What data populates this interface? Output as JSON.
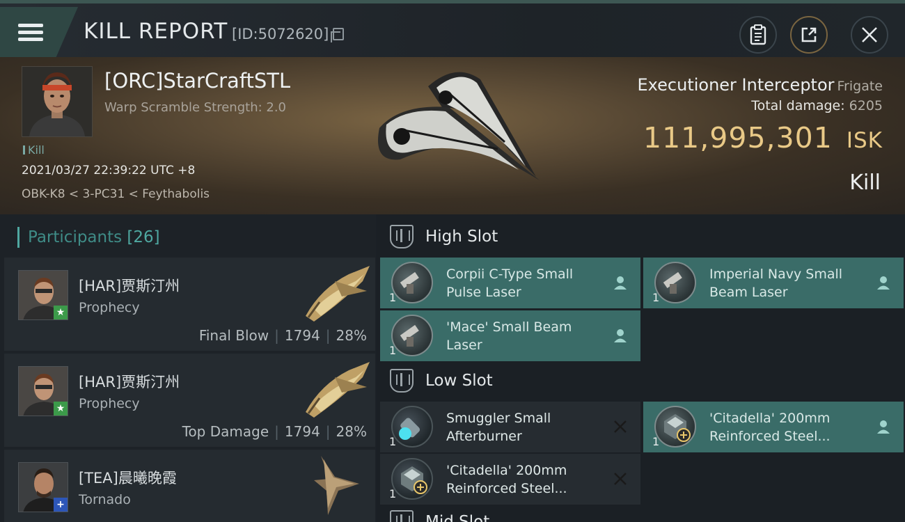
{
  "header": {
    "title": "KILL REPORT",
    "id_text": "[ID:5072620]"
  },
  "victim": {
    "name": "[ORC]StarCraftSTL",
    "warp_scramble": "Warp Scramble Strength: 2.0",
    "kill_tag": "Kill",
    "time": "2021/03/27 22:39:22 UTC +8",
    "location": "OBK-K8 < 3-PC31 < Feythabolis",
    "ship_name": "Executioner Interceptor",
    "ship_class": "Frigate",
    "total_damage_label": "Total damage:",
    "total_damage": "6205",
    "isk_value": "111,995,301",
    "isk_unit": "ISK",
    "result": "Kill"
  },
  "participants": {
    "label": "Participants",
    "count": "[26]",
    "rows": [
      {
        "name": "[HAR]贾斯汀州",
        "ship": "Prophecy",
        "role": "Final Blow",
        "damage": "1794",
        "percent": "28%",
        "badge": "★"
      },
      {
        "name": "[HAR]贾斯汀州",
        "ship": "Prophecy",
        "role": "Top Damage",
        "damage": "1794",
        "percent": "28%",
        "badge": "★"
      },
      {
        "name": "[TEA]晨曦晚霞",
        "ship": "Tornado",
        "role": "",
        "damage": "",
        "percent": "",
        "badge": "+"
      }
    ]
  },
  "fitting": {
    "high_slot": "High Slot",
    "low_slot": "Low Slot",
    "mid_slot": "Mid Slot",
    "high": [
      {
        "name": "Corpii C-Type Small Pulse Laser",
        "qty": "1",
        "status": "dropped"
      },
      {
        "name": "Imperial Navy Small Beam Laser",
        "qty": "1",
        "status": "dropped"
      },
      {
        "name": "'Mace' Small Beam Laser",
        "qty": "1",
        "status": "dropped"
      }
    ],
    "low": [
      {
        "name": "Smuggler Small Afterburner",
        "qty": "1",
        "status": "destroyed"
      },
      {
        "name": "'Citadella' 200mm Reinforced Steel...",
        "qty": "1",
        "status": "dropped"
      },
      {
        "name": "'Citadella' 200mm Reinforced Steel...",
        "qty": "1",
        "status": "destroyed"
      }
    ]
  },
  "colors": {
    "accent_teal": "#3a6c68",
    "isk_gold": "#e9c987",
    "participants_teal": "#4fa8a1"
  }
}
